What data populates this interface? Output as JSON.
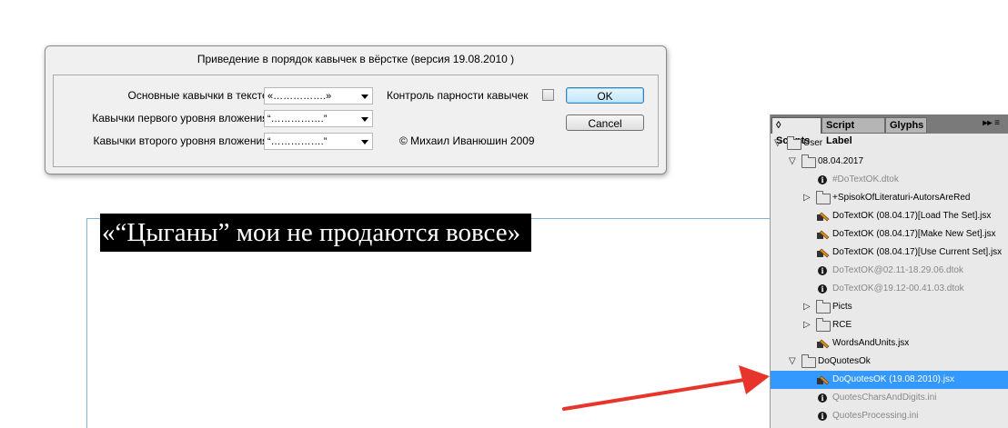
{
  "dialog": {
    "title": "Приведение в порядок кавычек в вёрстке (версия 19.08.2010 )",
    "fields": [
      {
        "label": "Основные кавычки в тексте:",
        "value": "«…………….»"
      },
      {
        "label": "Кавычки первого уровня вложения:",
        "value": "“…………….”"
      },
      {
        "label": "Кавычки второго уровня вложения:",
        "value": "“…………….”"
      }
    ],
    "checkbox_label": "Контроль парности кавычек",
    "checkbox_checked": false,
    "ok_label": "OK",
    "cancel_label": "Cancel",
    "copyright": "© Михаил Иванюшин 2009"
  },
  "document": {
    "sample_text": "«“Цыганы” мои не продаются вовсе»"
  },
  "panel": {
    "tabs": [
      {
        "label": "◊ Scripts",
        "active": true
      },
      {
        "label": "Script Label",
        "active": false
      },
      {
        "label": "Glyphs",
        "active": false
      }
    ],
    "menu_glyph": "▸▸ ≡",
    "items": [
      {
        "label": "User",
        "type": "folder",
        "expanded": true
      },
      {
        "label": "08.04.2017",
        "type": "folder",
        "expanded": true
      },
      {
        "label": "#DoTextOK.dtok",
        "type": "info",
        "gray": true
      },
      {
        "label": "+SpisokOfLiteraturi-AutorsAreRed",
        "type": "folder",
        "expanded": false
      },
      {
        "label": "DoTextOK (08.04.17)[Load The Set].jsx",
        "type": "jsx"
      },
      {
        "label": "DoTextOK (08.04.17)[Make New Set].jsx",
        "type": "jsx"
      },
      {
        "label": "DoTextOK (08.04.17)[Use Current Set].jsx",
        "type": "jsx"
      },
      {
        "label": "DoTextOK@02.11-18.29.06.dtok",
        "type": "info",
        "gray": true
      },
      {
        "label": "DoTextOK@19.12-00.41.03.dtok",
        "type": "info",
        "gray": true
      },
      {
        "label": "Picts",
        "type": "folder",
        "expanded": false
      },
      {
        "label": "RCE",
        "type": "folder",
        "expanded": false
      },
      {
        "label": "WordsAndUnits.jsx",
        "type": "jsx"
      },
      {
        "label": "DoQuotesOk",
        "type": "folder",
        "expanded": true
      },
      {
        "label": "DoQuotesOK (19.08.2010).jsx",
        "type": "jsx",
        "selected": true
      },
      {
        "label": "QuotesCharsAndDigits.ini",
        "type": "info",
        "gray": true
      },
      {
        "label": "QuotesProcessing.ini",
        "type": "info",
        "gray": true
      }
    ]
  },
  "colors": {
    "selection": "#3399ff",
    "arrow": "#e8352b",
    "frame_guide": "#7fb4d6"
  }
}
